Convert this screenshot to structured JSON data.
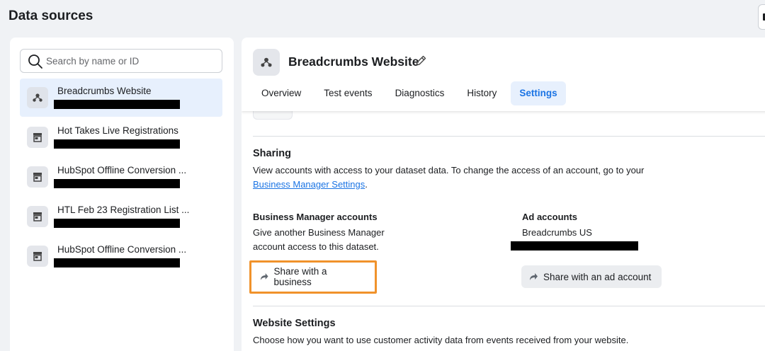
{
  "page": {
    "title": "Data sources"
  },
  "search": {
    "placeholder": "Search by name or ID",
    "value": ""
  },
  "sources": [
    {
      "name": "Breadcrumbs Website",
      "icon": "dataset-icon",
      "selected": true
    },
    {
      "name": "Hot Takes Live Registrations",
      "icon": "store-icon",
      "selected": false
    },
    {
      "name": "HubSpot Offline Conversion ...",
      "icon": "store-icon",
      "selected": false
    },
    {
      "name": "HTL Feb 23 Registration List ...",
      "icon": "store-icon",
      "selected": false
    },
    {
      "name": "HubSpot Offline Conversion ...",
      "icon": "store-icon",
      "selected": false
    }
  ],
  "dataset": {
    "title": "Breadcrumbs Website"
  },
  "tabs": [
    {
      "label": "Overview",
      "active": false
    },
    {
      "label": "Test events",
      "active": false
    },
    {
      "label": "Diagnostics",
      "active": false
    },
    {
      "label": "History",
      "active": false
    },
    {
      "label": "Settings",
      "active": true
    }
  ],
  "sharing": {
    "title": "Sharing",
    "description": "View accounts with access to your dataset data. To change the access of an account, go to your",
    "link_text": "Business Manager Settings",
    "link_suffix": ".",
    "bm": {
      "title": "Business Manager accounts",
      "line1": "Give another Business Manager",
      "line2": "account access to this dataset.",
      "button": "Share with a business"
    },
    "ad": {
      "title": "Ad accounts",
      "account": "Breadcrumbs US",
      "button": "Share with an ad account"
    }
  },
  "website_settings": {
    "title": "Website Settings",
    "description": "Choose how you want to use customer activity data from events received from your website."
  },
  "colors": {
    "accent": "#1b74e4",
    "highlight": "#f0922b",
    "selected_bg": "#e7f0fd"
  }
}
